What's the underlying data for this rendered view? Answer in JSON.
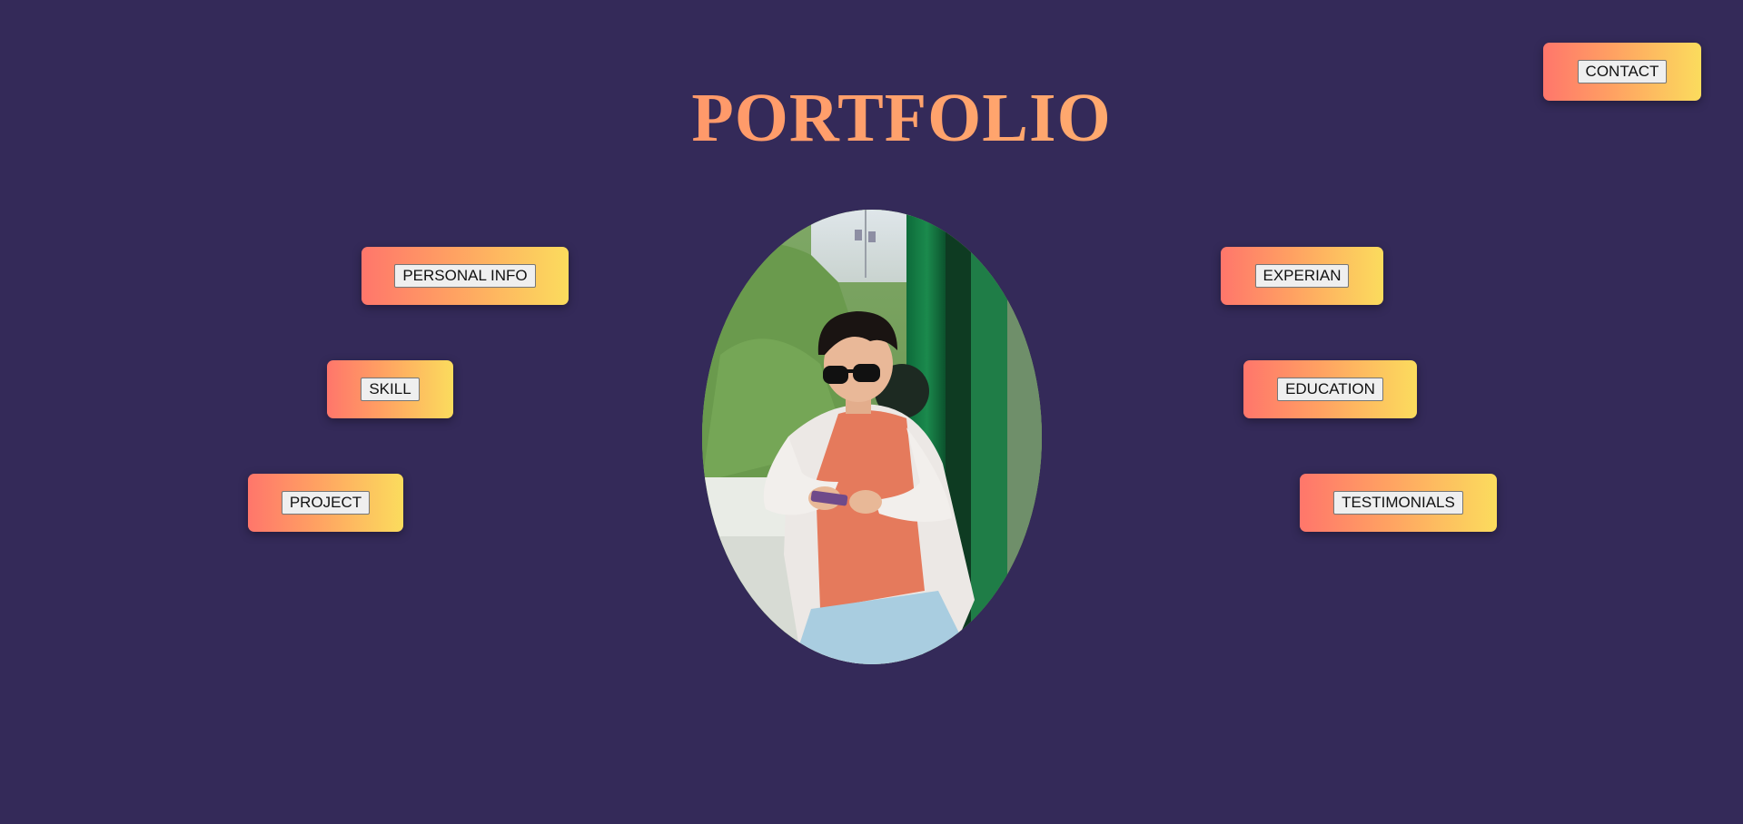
{
  "header": {
    "title": "PORTFOLIO",
    "contact_label": "CONTACT"
  },
  "nav": {
    "personal_info": "PERSONAL INFO",
    "skill": "SKILL",
    "project": "PROJECT",
    "experian": "EXPERIAN",
    "education": "EDUCATION",
    "testimonials": "TESTIMONIALS"
  },
  "colors": {
    "background": "#342a59",
    "card_gradient_start": "#ff766b",
    "card_gradient_end": "#fbdc5d",
    "title_gradient_start": "#ff7e62",
    "title_gradient_end": "#ffc27a"
  }
}
